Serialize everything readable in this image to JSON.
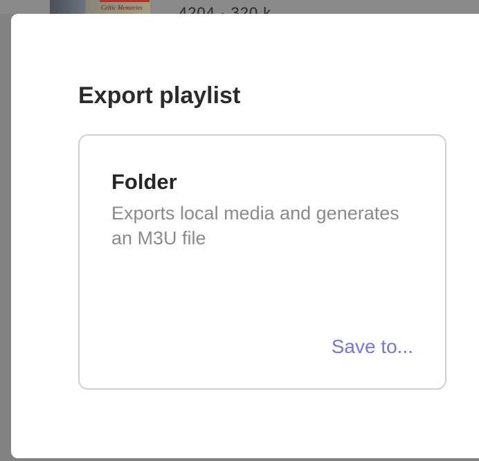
{
  "background": {
    "artwork_caption": "Celtic Memories",
    "meta_text": "4204 · 320 k"
  },
  "dialog": {
    "title": "Export playlist",
    "option": {
      "title": "Folder",
      "description": "Exports local media and generates an M3U file",
      "action_label": "Save to..."
    }
  },
  "colors": {
    "accent": "#7776d8",
    "title_text": "#262626",
    "secondary_text": "#8a8a8a",
    "card_border": "#d0d0d0",
    "backdrop": "#828282"
  }
}
